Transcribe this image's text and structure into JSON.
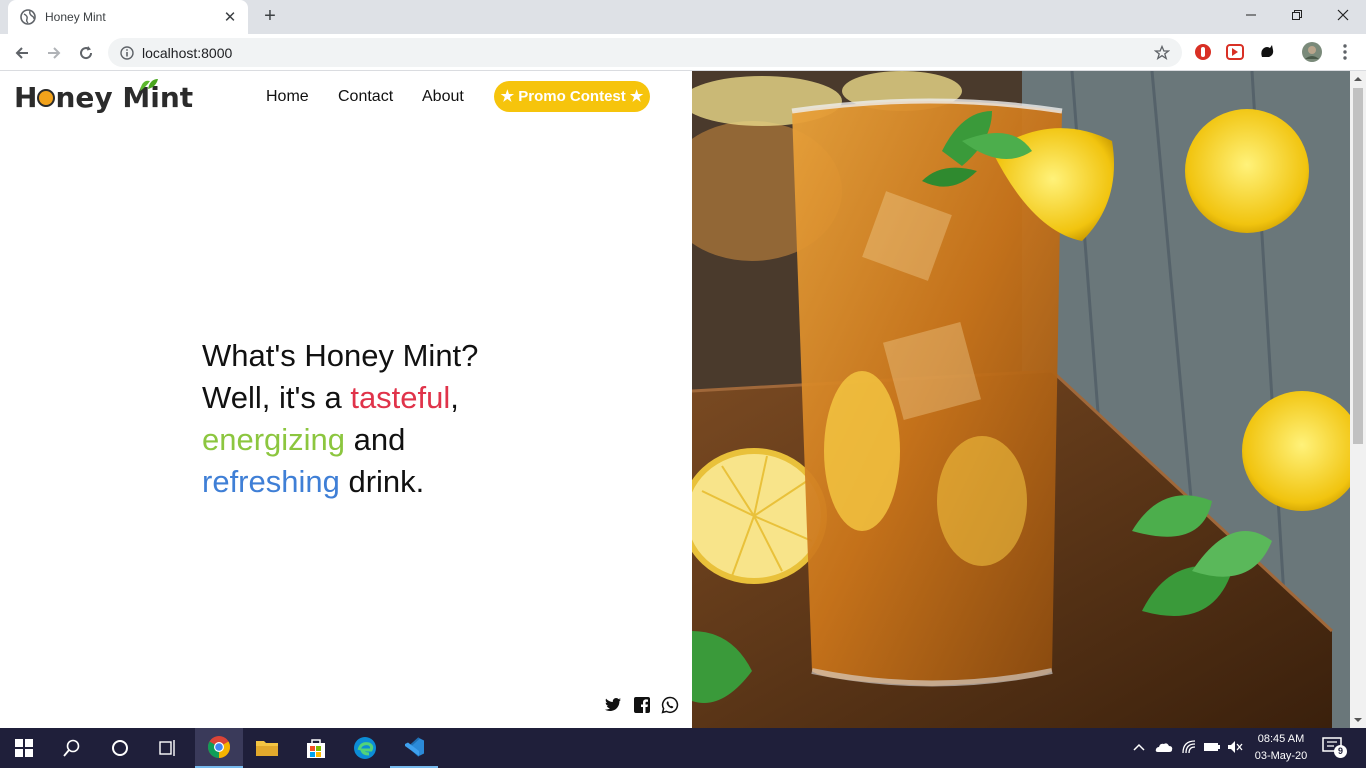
{
  "browser": {
    "tab_title": "Honey Mint",
    "url": "localhost:8000",
    "new_tab_symbol": "+",
    "close_tab_symbol": "✕"
  },
  "site": {
    "logo_text_1": "H",
    "logo_text_2": "ney Mint",
    "nav": [
      "Home",
      "Contact",
      "About"
    ],
    "promo_label": "★ Promo Contest ★",
    "hero": {
      "line1": "What's Honey Mint?",
      "line2_pre": "Well, it's a ",
      "line2_red": "tasteful",
      "line2_post": ",",
      "line3_green": "energizing",
      "line3_post": " and",
      "line4_blue": "refreshing",
      "line4_post": " drink."
    },
    "social_icons": [
      "twitter-icon",
      "facebook-icon",
      "whatsapp-icon"
    ],
    "colors": {
      "promo": "#f6c40c",
      "red": "#e0334a",
      "green": "#8cc63f",
      "blue": "#3f7fd6"
    }
  },
  "taskbar": {
    "time": "08:45 AM",
    "date": "03-May-20",
    "notification_count": "9"
  }
}
